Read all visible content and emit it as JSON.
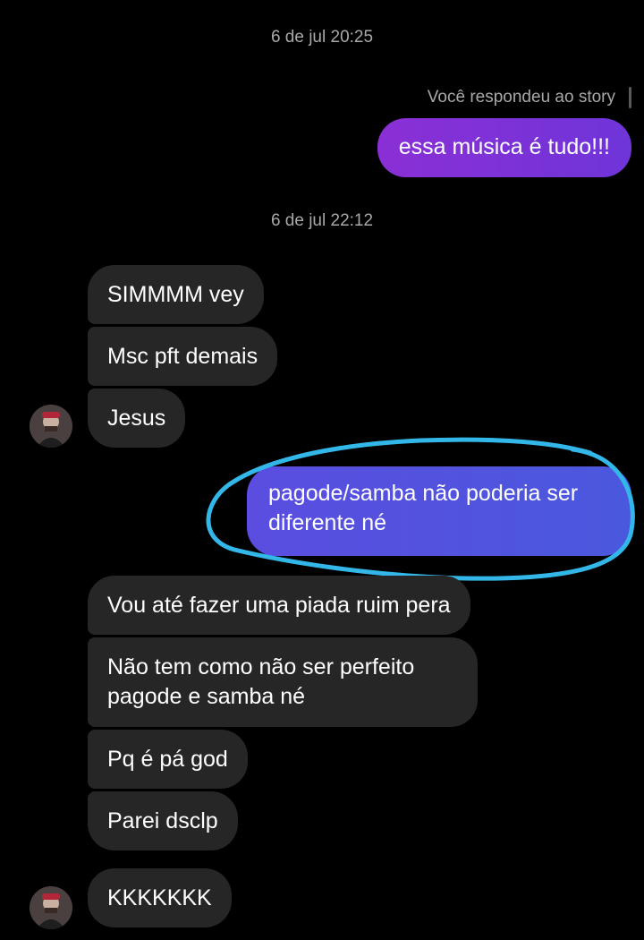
{
  "timestamps": [
    "6 de jul 20:25",
    "6 de jul 22:12"
  ],
  "story_reply_note": "Você respondeu ao story",
  "messages": [
    {
      "side": "out",
      "text": "essa música é tudo!!!"
    },
    {
      "side": "in",
      "text": "SIMMMM vey"
    },
    {
      "side": "in",
      "text": "Msc pft demais"
    },
    {
      "side": "in",
      "text": "Jesus"
    },
    {
      "side": "out",
      "text": "pagode/samba não poderia ser diferente né"
    },
    {
      "side": "in",
      "text": "Vou até fazer uma piada ruim pera"
    },
    {
      "side": "in",
      "text": "Não tem como não ser perfeito pagode e samba né"
    },
    {
      "side": "in",
      "text": "Pq é pá god"
    },
    {
      "side": "in",
      "text": "Parei dsclp"
    },
    {
      "side": "in",
      "text": "KKKKKKK"
    }
  ],
  "colors": {
    "background": "#000000",
    "incoming_bubble": "#262626",
    "outgoing_bubble_purple": "#7b2fd6",
    "outgoing_bubble_blue": "#4a58dd",
    "annotation_circle": "#33b7e8",
    "meta_text": "#a8a8a8"
  }
}
